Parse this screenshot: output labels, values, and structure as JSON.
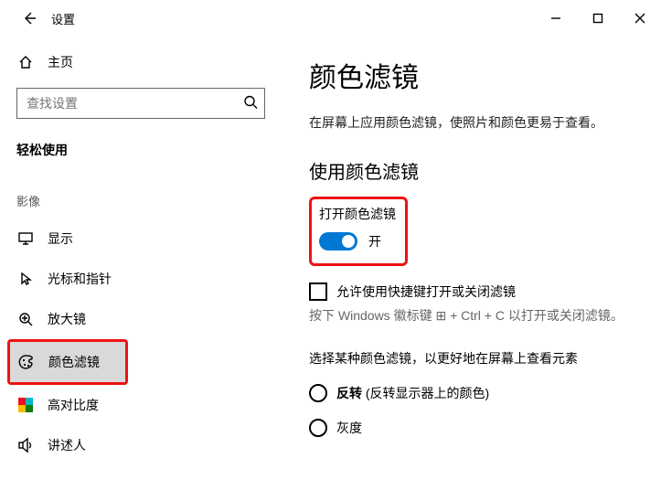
{
  "window": {
    "title": "设置"
  },
  "sidebar": {
    "home": "主页",
    "search_placeholder": "查找设置",
    "category": "轻松使用",
    "subheader": "影像",
    "items": [
      {
        "label": "显示"
      },
      {
        "label": "光标和指针"
      },
      {
        "label": "放大镜"
      },
      {
        "label": "颜色滤镜"
      },
      {
        "label": "高对比度"
      },
      {
        "label": "讲述人"
      }
    ]
  },
  "content": {
    "title": "颜色滤镜",
    "description": "在屏幕上应用颜色滤镜，使照片和颜色更易于查看。",
    "section1_heading": "使用颜色滤镜",
    "toggle_label": "打开颜色滤镜",
    "toggle_state": "开",
    "checkbox_label": "允许使用快捷键打开或关闭滤镜",
    "hint": "按下 Windows 徽标键 ⊞ + Ctrl + C 以打开或关闭滤镜。",
    "section2_lead": "选择某种颜色滤镜，以更好地在屏幕上查看元素",
    "radios": [
      {
        "label": "反转 (反转显示器上的颜色)",
        "bold_prefix": "反转"
      },
      {
        "label": "灰度"
      }
    ]
  }
}
